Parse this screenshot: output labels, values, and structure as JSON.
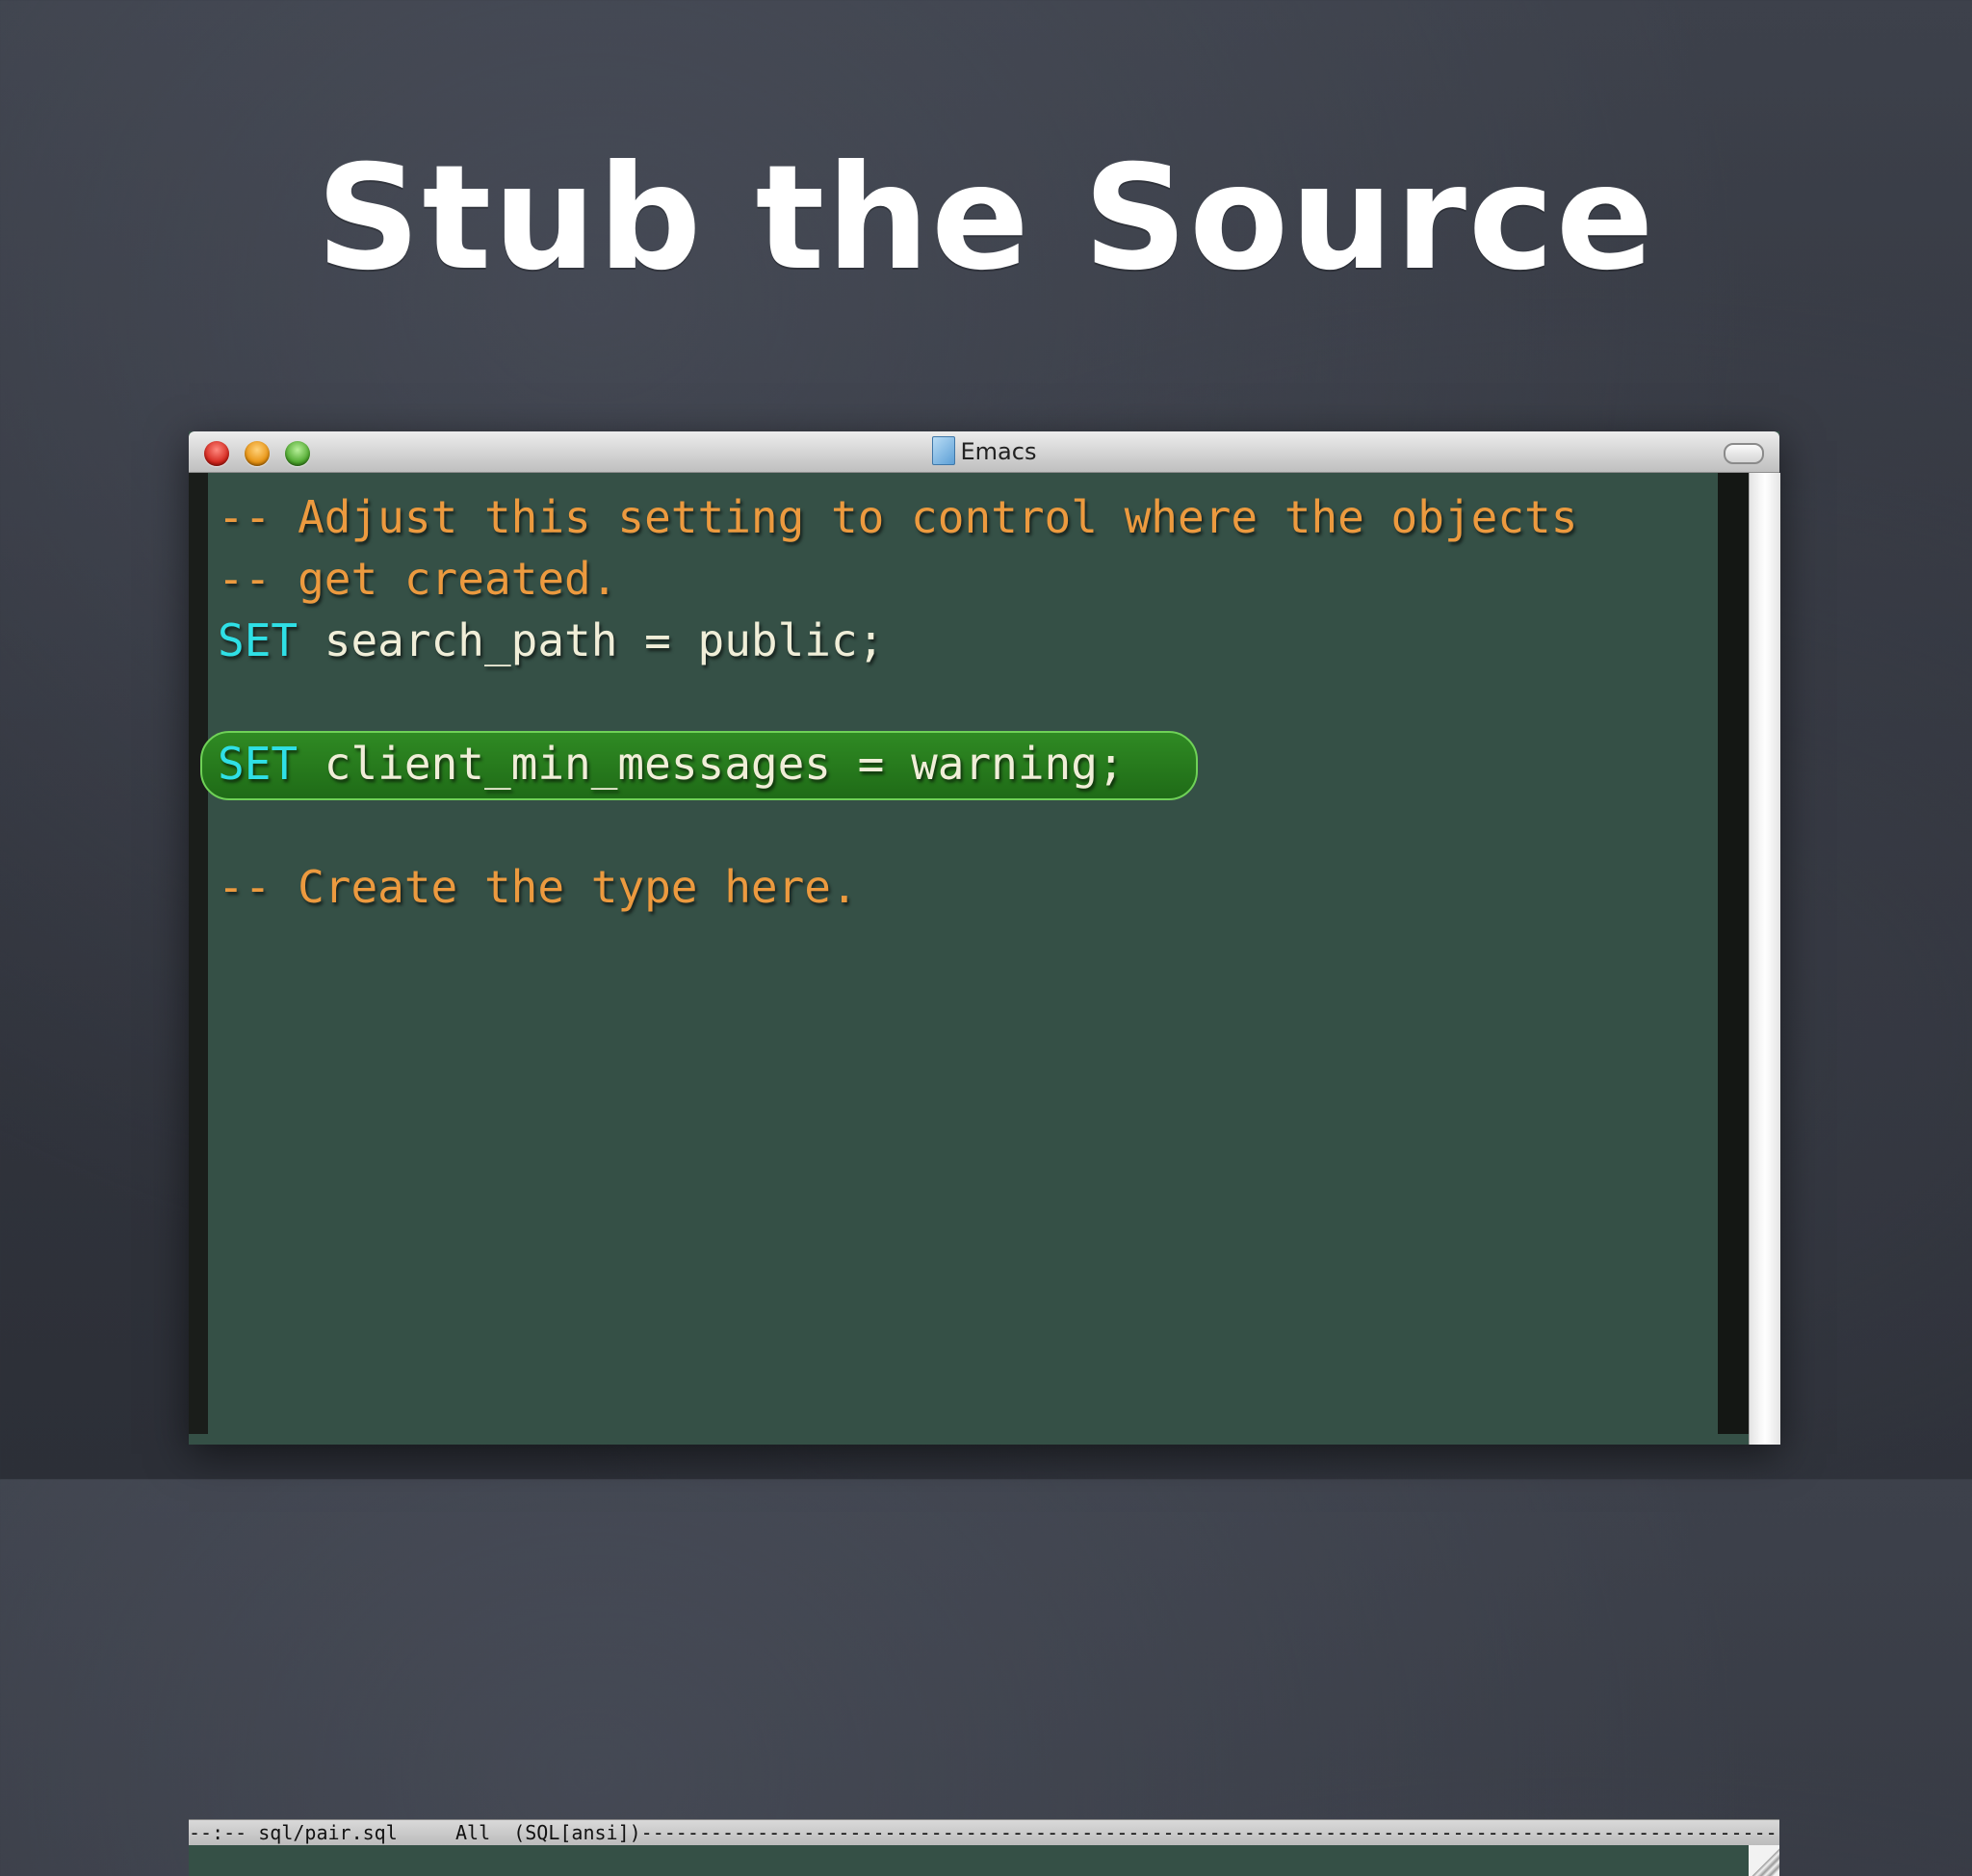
{
  "slide": {
    "title": "Stub the Source"
  },
  "window": {
    "title": "Emacs",
    "icons": {
      "close": "close-icon",
      "minimize": "minimize-icon",
      "zoom": "zoom-icon",
      "document": "document-icon",
      "toolbar_toggle": "toolbar-toggle-icon"
    }
  },
  "editor": {
    "lines": [
      {
        "parts": [
          {
            "type": "comment",
            "text": "-- Adjust this setting to control where the objects"
          }
        ]
      },
      {
        "parts": [
          {
            "type": "comment",
            "text": "-- get created."
          }
        ]
      },
      {
        "parts": [
          {
            "type": "keyword",
            "text": "SET"
          },
          {
            "type": "plain",
            "text": " search_path = public;"
          }
        ]
      },
      {
        "parts": []
      },
      {
        "parts": [
          {
            "type": "keyword",
            "text": "SET"
          },
          {
            "type": "plain",
            "text": " client_min_messages = warning;"
          }
        ],
        "highlighted": true
      },
      {
        "parts": []
      },
      {
        "parts": [
          {
            "type": "comment",
            "text": "-- Create the type here."
          }
        ]
      }
    ]
  },
  "modeline": {
    "status": "--:--",
    "buffer": "sql/pair.sql",
    "position": "All",
    "mode": "(SQL[ansi])"
  },
  "colors": {
    "background": "#355046",
    "comment": "#ec9a3f",
    "keyword": "#2fe0e6",
    "plain": "#f0eed8",
    "highlight": "#2f8a23"
  }
}
